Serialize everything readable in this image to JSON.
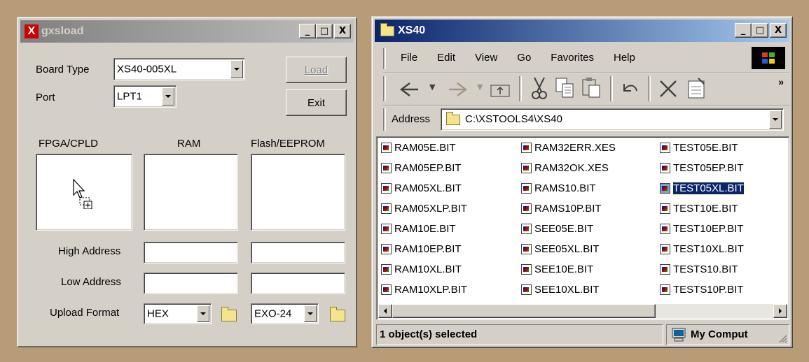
{
  "gxsload": {
    "title": "gxsload",
    "title_icon_glyph": "X",
    "board_type_label": "Board Type",
    "board_type_value": "XS40-005XL",
    "port_label": "Port",
    "port_value": "LPT1",
    "load_label": "Load",
    "exit_label": "Exit",
    "col_fpga": "FPGA/CPLD",
    "col_ram": "RAM",
    "col_flash": "Flash/EEPROM",
    "high_address_label": "High Address",
    "low_address_label": "Low Address",
    "upload_format_label": "Upload Format",
    "ram_format_value": "HEX",
    "flash_format_value": "EXO-24"
  },
  "explorer": {
    "title": "XS40",
    "menu": [
      "File",
      "Edit",
      "View",
      "Go",
      "Favorites",
      "Help"
    ],
    "address_label": "Address",
    "address_value": "C:\\XSTOOLS4\\XS40",
    "files": [
      [
        "RAM05E.BIT",
        "RAM05EP.BIT",
        "RAM05XL.BIT",
        "RAM05XLP.BIT",
        "RAM10E.BIT",
        "RAM10EP.BIT",
        "RAM10XL.BIT",
        "RAM10XLP.BIT"
      ],
      [
        "RAM32ERR.XES",
        "RAM32OK.XES",
        "RAMS10.BIT",
        "RAMS10P.BIT",
        "SEE05E.BIT",
        "SEE05XL.BIT",
        "SEE10E.BIT",
        "SEE10XL.BIT"
      ],
      [
        "TEST05E.BIT",
        "TEST05EP.BIT",
        "TEST05XL.BIT",
        "TEST10E.BIT",
        "TEST10EP.BIT",
        "TEST10XL.BIT",
        "TESTS10.BIT",
        "TESTS10P.BIT"
      ]
    ],
    "selected_file": "TEST05XL.BIT",
    "status_text": "1 object(s) selected",
    "status_zone": "My Comput",
    "chevron": "»",
    "min_glyph": "_",
    "max_glyph": "□",
    "close_glyph": "X"
  }
}
